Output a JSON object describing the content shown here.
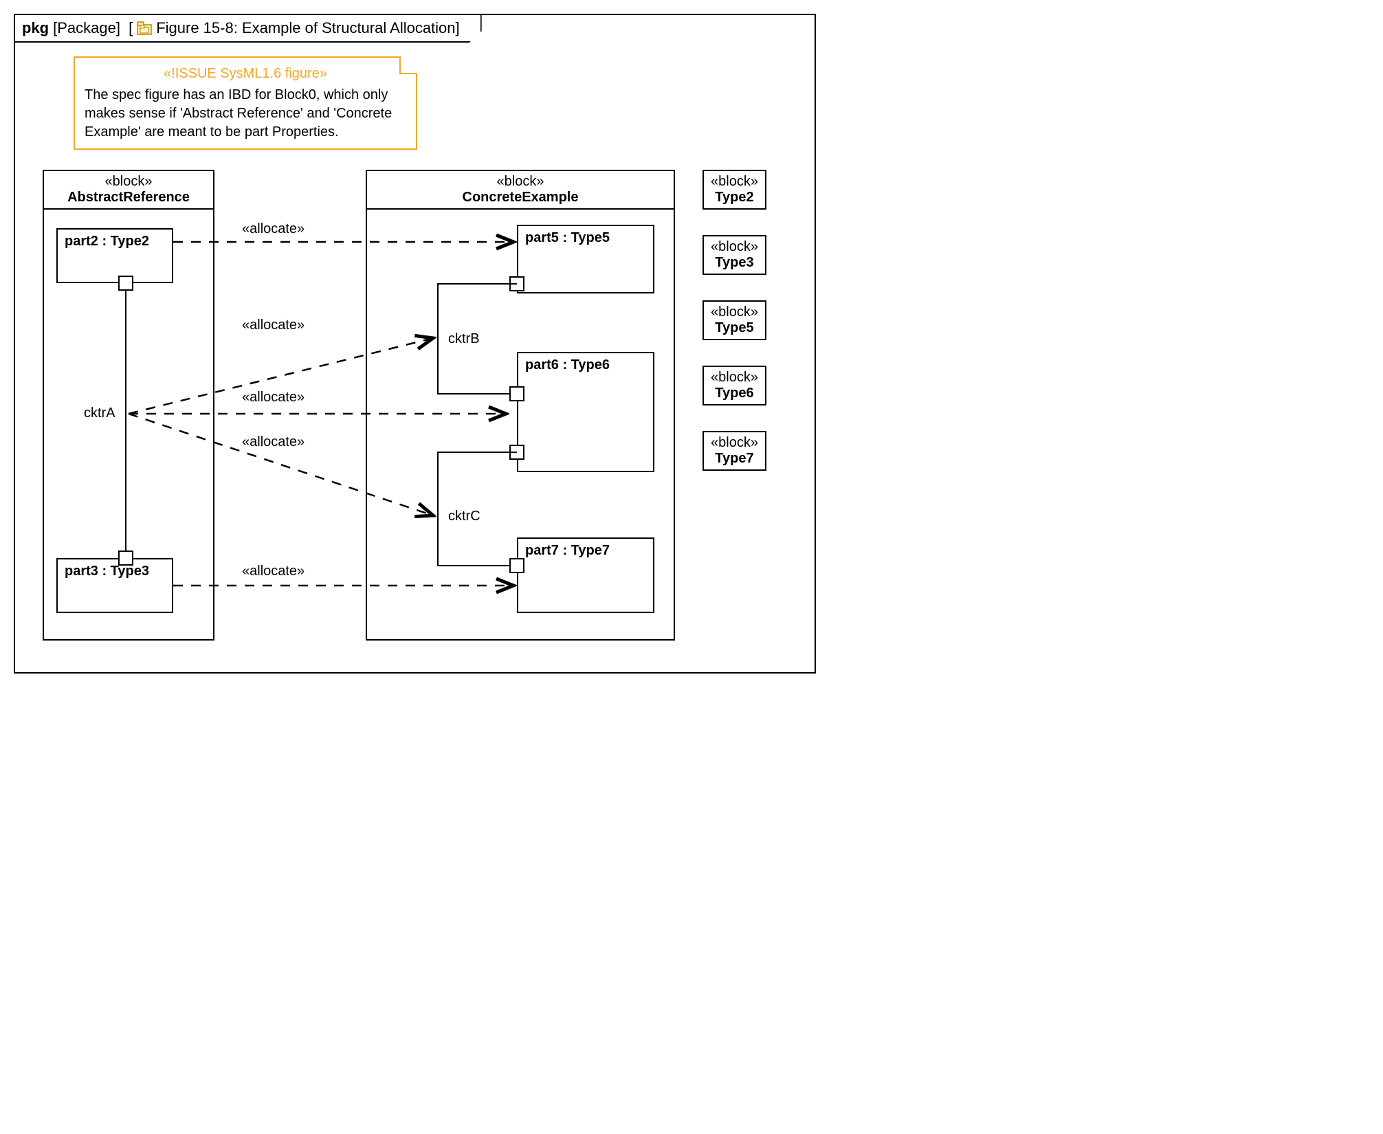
{
  "header": {
    "pkg": "pkg",
    "type": "[Package]",
    "title": "Figure 15-8: Example of Structural Allocation]"
  },
  "note": {
    "title": "«!ISSUE SysML1.6 figure»",
    "body": "The spec figure has an IBD for Block0, which only makes sense if 'Abstract Reference' and 'Concrete Example' are meant to be part Properties."
  },
  "blocks": {
    "abstract": {
      "stereo": "«block»",
      "name": "AbstractReference"
    },
    "concrete": {
      "stereo": "«block»",
      "name": "ConcreteExample"
    }
  },
  "parts": {
    "part2": "part2 : Type2",
    "part3": "part3 : Type3",
    "part5": "part5 : Type5",
    "part6": "part6 : Type6",
    "part7": "part7 : Type7"
  },
  "connectors": {
    "cktrA": "cktrA",
    "cktrB": "cktrB",
    "cktrC": "cktrC"
  },
  "allocate": "«allocate»",
  "types": {
    "stereo": "«block»",
    "t2": "Type2",
    "t3": "Type3",
    "t5": "Type5",
    "t6": "Type6",
    "t7": "Type7"
  }
}
